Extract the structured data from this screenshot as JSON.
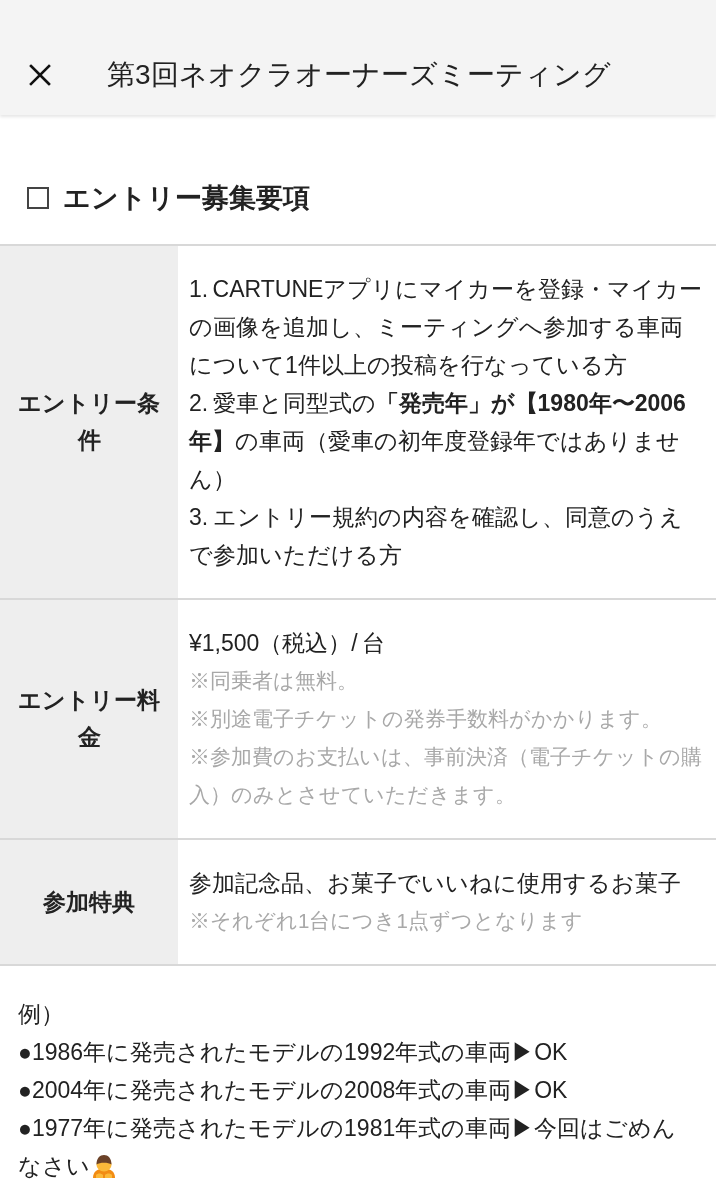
{
  "header": {
    "title": "第3回ネオクラオーナーズミーティング"
  },
  "section": {
    "title": "エントリー募集要項"
  },
  "table": {
    "rows": [
      {
        "label": "エントリー条件",
        "lines": [
          {
            "kind": "main",
            "text": "1. CARTUNEアプリにマイカーを登録・マイカーの画像を追加し、ミーティングへ参加する車両について1件以上の投稿を行なっている方"
          },
          {
            "kind": "main",
            "text": "2. 愛車と同型式の**「発売年」が【1980年〜2006年】**の車両（愛車の初年度登録年ではありません）"
          },
          {
            "kind": "main",
            "text": "3. エントリー規約の内容を確認し、同意のうえで参加いただける方"
          }
        ]
      },
      {
        "label": "エントリー料金",
        "lines": [
          {
            "kind": "main",
            "text": "¥1,500（税込）/ 台"
          },
          {
            "kind": "note",
            "text": "※同乗者は無料。"
          },
          {
            "kind": "note",
            "text": "※別途電子チケットの発券手数料がかかります。"
          },
          {
            "kind": "note",
            "text": "※参加費のお支払いは、事前決済（電子チケットの購入）のみとさせていただきます。"
          }
        ]
      },
      {
        "label": "参加特典",
        "lines": [
          {
            "kind": "main",
            "text": "参加記念品、お菓子でいいねに使用するお菓子"
          },
          {
            "kind": "note",
            "text": "※それぞれ1台につき1点ずつとなります"
          }
        ]
      }
    ]
  },
  "examples": {
    "heading": "例）",
    "items": [
      {
        "text": "●1986年に発売されたモデルの1992年式の車両▶OK",
        "trailing_icon": false
      },
      {
        "text": "●2004年に発売されたモデルの2008年式の車両▶OK",
        "trailing_icon": false
      },
      {
        "text": "●1977年に発売されたモデルの1981年式の車両▶今回はごめんなさい",
        "trailing_icon": true
      }
    ]
  }
}
